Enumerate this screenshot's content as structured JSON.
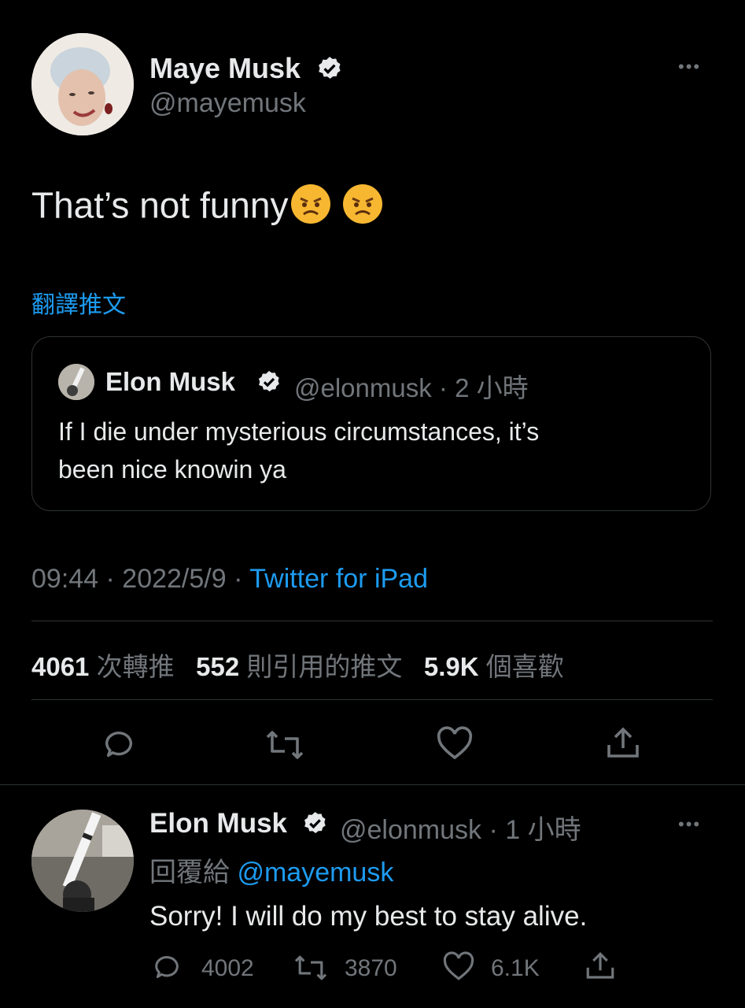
{
  "main_tweet": {
    "author_name": "Maye Musk",
    "author_handle": "@mayemusk",
    "text": "That’s not funny",
    "emojis": [
      "angry-face",
      "angry-face"
    ],
    "translate_link": "翻譯推文",
    "timestamp": "09:44 · 2022/5/9 · ",
    "source": "Twitter for iPad"
  },
  "quoted_tweet": {
    "author_name": "Elon Musk",
    "author_handle": "@elonmusk",
    "time": "· 2 小時",
    "text_line1": "If I die under mysterious circumstances, it’s",
    "text_line2": "been nice knowin ya"
  },
  "stats": {
    "retweets_count": "4061",
    "retweets_label": "次轉推",
    "quotes_count": "552",
    "quotes_label": "則引用的推文",
    "likes_count": "5.9K",
    "likes_label": "個喜歡"
  },
  "actions": [
    "reply-icon",
    "retweet-icon",
    "like-icon",
    "share-icon"
  ],
  "reply": {
    "author_name": "Elon Musk",
    "author_handle": "@elonmusk",
    "time": "· 1 小時",
    "replying_to_label": "回覆給 ",
    "replying_to_handle": "@mayemusk",
    "text": "Sorry! I will do my best to stay alive.",
    "reply_count": "4002",
    "retweet_count": "3870",
    "like_count": "6.1K"
  },
  "colors": {
    "background": "#000000",
    "accent": "#1d9bf0",
    "muted": "#71767b",
    "text": "#e7e9ea"
  }
}
